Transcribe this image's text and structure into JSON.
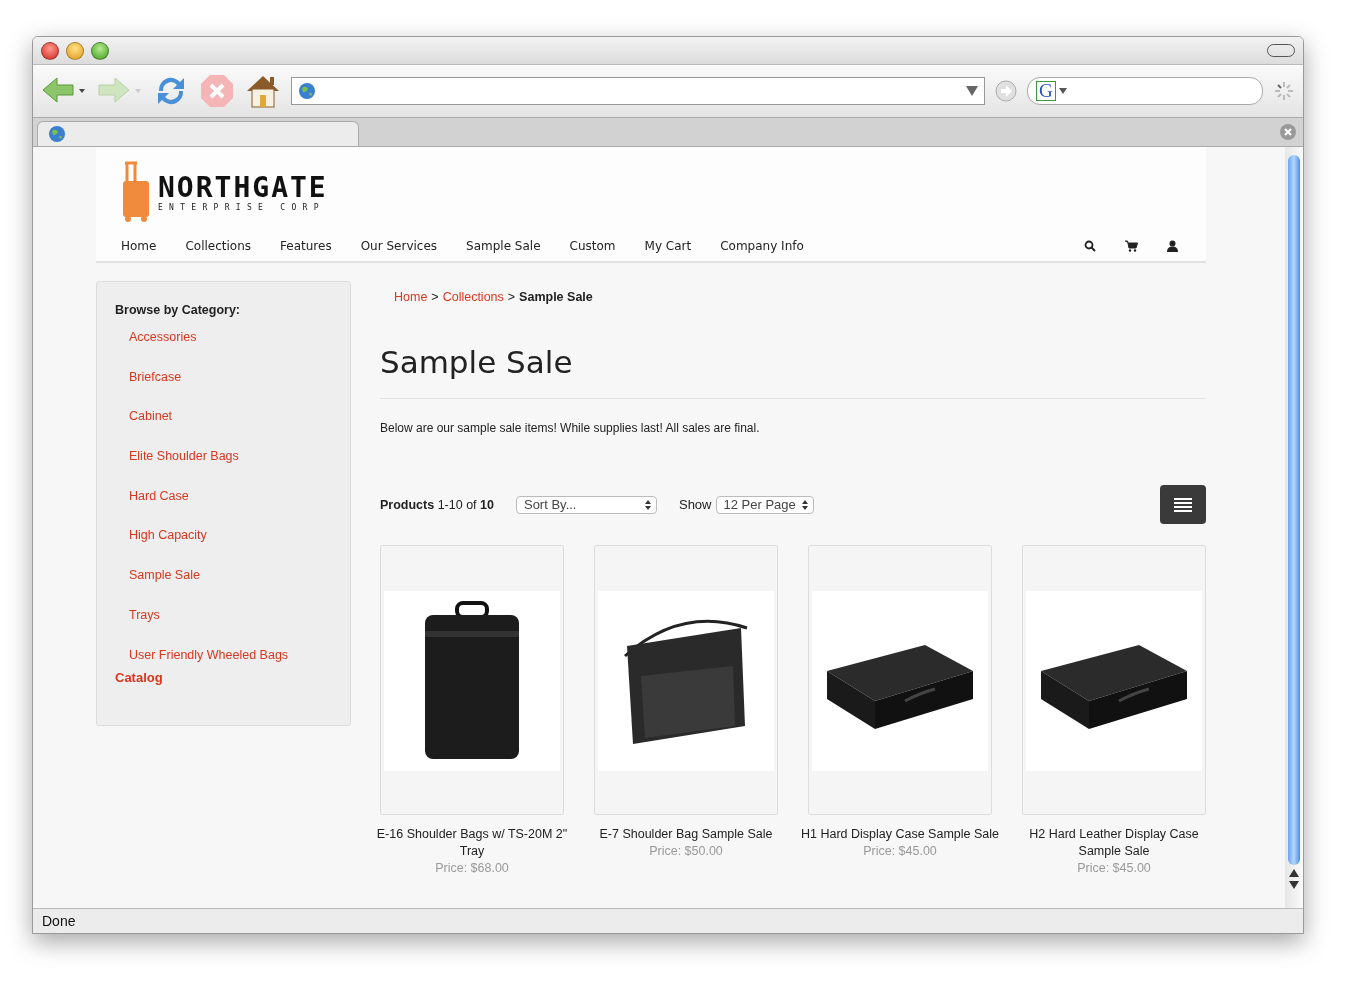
{
  "browser": {
    "search_engine": "G",
    "status": "Done"
  },
  "logo": {
    "name": "NORTHGATE",
    "tagline": "ENTERPRISE CORP"
  },
  "nav": [
    "Home",
    "Collections",
    "Features",
    "Our Services",
    "Sample Sale",
    "Custom",
    "My Cart",
    "Company Info"
  ],
  "sidebar": {
    "heading": "Browse by Category:",
    "items": [
      "Accessories",
      "Briefcase",
      "Cabinet",
      "Elite Shoulder Bags",
      "Hard Case",
      "High Capacity",
      "Sample Sale",
      "Trays",
      "User Friendly Wheeled Bags"
    ],
    "footer_link": "Catalog"
  },
  "breadcrumb": {
    "separator": ">",
    "items": [
      {
        "label": "Home",
        "current": false
      },
      {
        "label": "Collections",
        "current": false
      },
      {
        "label": "Sample Sale",
        "current": true
      }
    ]
  },
  "title": "Sample Sale",
  "intro": "Below are our sample sale items! While supplies last! All sales are final.",
  "toolbar": {
    "count": "**Products** 1-10 of **10**",
    "sort": "Sort By...",
    "show_label": "Show",
    "per_page": "12 Per Page"
  },
  "products": [
    {
      "kind": "tall-bag",
      "name": "E-16 Shoulder Bags w/ TS-20M 2\" Tray",
      "price": "Price: $68.00"
    },
    {
      "kind": "wide-bag",
      "name": "E-7 Shoulder Bag Sample Sale",
      "price": "Price: $50.00"
    },
    {
      "kind": "case",
      "name": "H1 Hard Display Case Sample Sale",
      "price": "Price: $45.00"
    },
    {
      "kind": "case",
      "name": "H2 Hard Leather Display Case Sample Sale",
      "price": "Price: $45.00"
    }
  ]
}
